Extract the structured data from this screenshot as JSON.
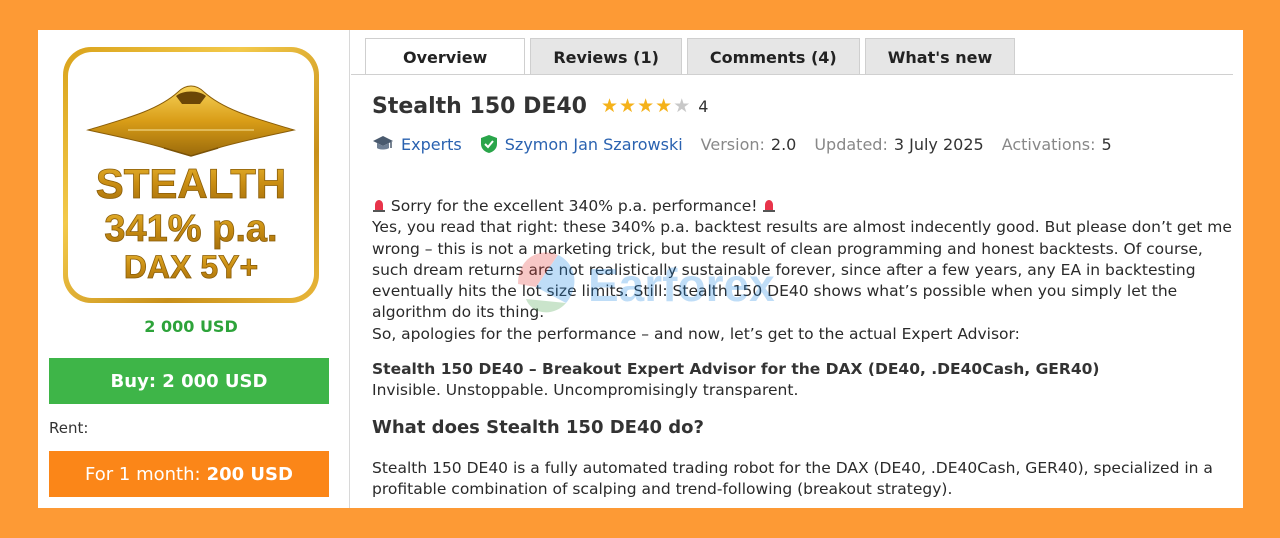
{
  "product": {
    "image_text": {
      "line1": "STEALTH",
      "line2": "341% p.a.",
      "line3": "DAX 5Y+"
    },
    "price": "2 000 USD",
    "buy_label": "Buy: 2 000 USD",
    "rent_label": "Rent:",
    "rent_period": "For 1 month:",
    "rent_price": "200 USD"
  },
  "tabs": [
    {
      "label": "Overview",
      "active": true
    },
    {
      "label": "Reviews (1)",
      "active": false
    },
    {
      "label": "Comments (4)",
      "active": false
    },
    {
      "label": "What's new",
      "active": false
    }
  ],
  "header": {
    "title": "Stealth 150 DE40",
    "rating": "4",
    "stars_filled": 4,
    "stars_total": 5
  },
  "meta": {
    "category": "Experts",
    "author": "Szymon Jan Szarowski",
    "version_label": "Version:",
    "version": "2.0",
    "updated_label": "Updated:",
    "updated": "3 July 2025",
    "activations_label": "Activations:",
    "activations": "5"
  },
  "description": {
    "apology_line": " Sorry for the excellent 340% p.a. performance! ",
    "para1": "Yes, you read that right: these 340% p.a. backtest results are almost indecently good. But please don’t get me wrong – this is not a marketing trick, but the result of clean programming and honest backtests. Of course, such dream returns are not realistically sustainable forever, since after a few years, any EA in backtesting eventually hits the lot size limits. Still: Stealth 150 DE40 shows what’s possible when you simply let the algorithm do its thing.",
    "para2": "So, apologies for the performance – and now, let’s get to the actual Expert Advisor:",
    "subtitle": "Stealth 150 DE40 – Breakout Expert Advisor for the DAX (DE40, .DE40Cash, GER40)",
    "tagline": "Invisible. Unstoppable. Uncompromisingly transparent.",
    "heading": "What does Stealth 150 DE40 do?",
    "para3": "Stealth 150 DE40 is a fully automated trading robot for the DAX (DE40, .DE40Cash, GER40), specialized in a profitable combination of scalping and trend-following (breakout strategy)."
  },
  "watermark": "Earforex",
  "colors": {
    "background": "#fd9a35",
    "buy_button": "#3eb548",
    "rent_button": "#fb8618",
    "price_green": "#2da33a",
    "link_blue": "#2a62b0",
    "star_gold": "#f5b21a"
  }
}
